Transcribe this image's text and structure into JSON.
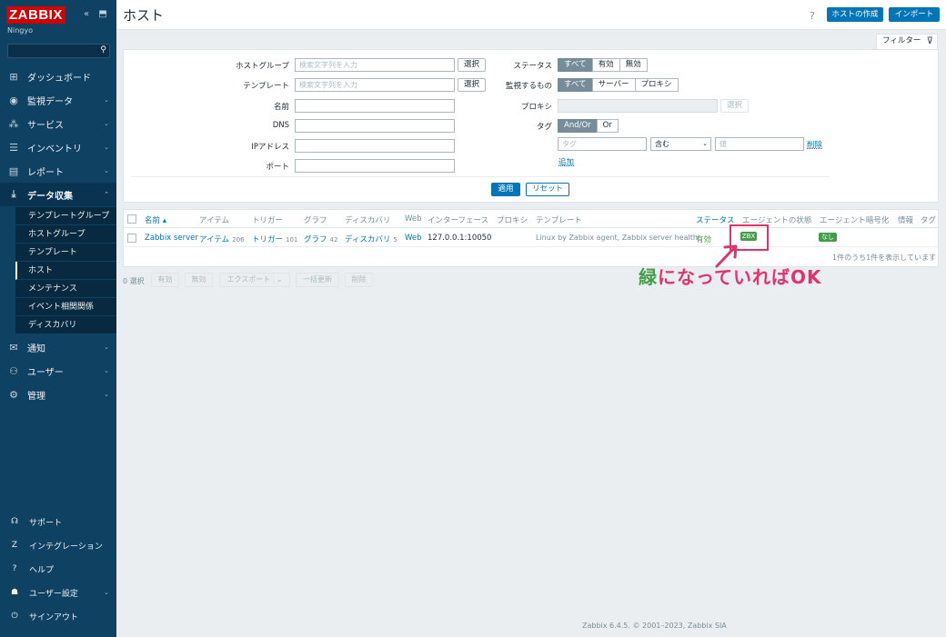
{
  "sidebar": {
    "logo": "ZABBIX",
    "server_name": "Ningyo",
    "collapse_icons": [
      "«",
      "⬒"
    ],
    "nav": [
      {
        "label": "ダッシュボード",
        "icon": "dashboard-icon",
        "glyph": "⊞"
      },
      {
        "label": "監視データ",
        "icon": "eye-icon",
        "glyph": "◉",
        "chevron": "⌄"
      },
      {
        "label": "サービス",
        "icon": "services-icon",
        "glyph": "⁂",
        "chevron": "⌄"
      },
      {
        "label": "インベントリ",
        "icon": "list-icon",
        "glyph": "☰",
        "chevron": "⌄"
      },
      {
        "label": "レポート",
        "icon": "report-icon",
        "glyph": "▤",
        "chevron": "⌄"
      },
      {
        "label": "データ収集",
        "icon": "download-icon",
        "glyph": "⤓",
        "chevron": "⌃"
      }
    ],
    "submenu": [
      "テンプレートグループ",
      "ホストグループ",
      "テンプレート",
      "ホスト",
      "メンテナンス",
      "イベント相関関係",
      "ディスカバリ"
    ],
    "nav2": [
      {
        "label": "通知",
        "glyph": "✉",
        "chevron": "⌄"
      },
      {
        "label": "ユーザー",
        "glyph": "⚇",
        "chevron": "⌄"
      },
      {
        "label": "管理",
        "glyph": "⚙",
        "chevron": "⌄"
      }
    ],
    "bottom": [
      {
        "label": "サポート",
        "glyph": "☊"
      },
      {
        "label": "インテグレーション",
        "glyph": "Z"
      },
      {
        "label": "ヘルプ",
        "glyph": "?"
      },
      {
        "label": "ユーザー設定",
        "glyph": "☗",
        "chevron": "⌄"
      },
      {
        "label": "サインアウト",
        "glyph": "⏻"
      }
    ]
  },
  "header": {
    "title": "ホスト",
    "help": "?",
    "create_host": "ホストの作成",
    "import": "インポート"
  },
  "filter": {
    "tab_label": "フィルター",
    "host_group_label": "ホストグループ",
    "host_group_placeholder": "検索文字列を入力",
    "template_label": "テンプレート",
    "template_placeholder": "検索文字列を入力",
    "select": "選択",
    "name_label": "名前",
    "dns_label": "DNS",
    "ip_label": "IPアドレス",
    "port_label": "ポート",
    "status_label": "ステータス",
    "status_options": [
      "すべて",
      "有効",
      "無効"
    ],
    "monitored_by_label": "監視するもの",
    "monitored_by_options": [
      "すべて",
      "サーバー",
      "プロキシ"
    ],
    "proxy_label": "プロキシ",
    "tags_label": "タグ",
    "tags_options": [
      "And/Or",
      "Or"
    ],
    "tag_placeholder": "タグ",
    "tag_operator": "含む",
    "value_placeholder": "値",
    "remove": "削除",
    "add": "追加",
    "apply": "適用",
    "reset": "リセット"
  },
  "table": {
    "headers": [
      "名前 ▴",
      "アイテム",
      "トリガー",
      "グラフ",
      "ディスカバリ",
      "Web",
      "インターフェース",
      "プロキシ",
      "テンプレート",
      "ステータス",
      "エージェントの状態",
      "エージェント暗号化",
      "情報",
      "タグ"
    ],
    "row": {
      "name": "Zabbix server",
      "items": "アイテム",
      "items_count": "206",
      "triggers": "トリガー",
      "triggers_count": "101",
      "graphs": "グラフ",
      "graphs_count": "42",
      "discovery": "ディスカバリ",
      "discovery_count": "5",
      "web": "Web",
      "interface": "127.0.0.1:10050",
      "templates": "Linux by Zabbix agent, Zabbix server health",
      "status": "有効",
      "availability": "ZBX",
      "encryption": "なし"
    },
    "count_text": "1件のうち1件を表示しています"
  },
  "mass_actions": {
    "selected": "0 選択",
    "enable": "有効",
    "disable": "無効",
    "export": "エクスポート",
    "mass_update": "一括更新",
    "delete": "削除"
  },
  "annotation": {
    "green_part": "緑",
    "rest": "になっていればOK"
  },
  "footer": "Zabbix 6.4.5. © 2001–2023, Zabbix SIA"
}
